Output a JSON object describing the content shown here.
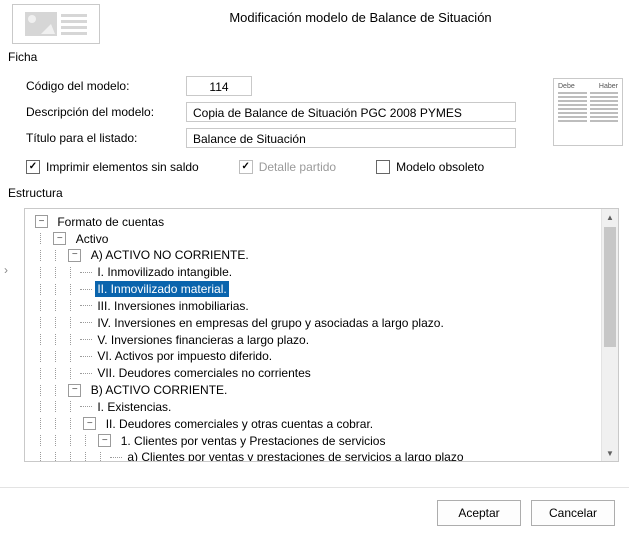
{
  "header": {
    "title": "Modificación  modelo de Balance de Situación"
  },
  "ficha": {
    "section": "Ficha",
    "codigo_lbl": "Código del modelo:",
    "codigo_val": "114",
    "desc_lbl": "Descripción del modelo:",
    "desc_val": "Copia de Balance de Situación PGC 2008 PYMES",
    "titulo_lbl": "Título para el listado:",
    "titulo_val": "Balance de Situación",
    "chk_imprimir": "Imprimir elementos sin saldo",
    "chk_detalle": "Detalle partido",
    "chk_obsoleto": "Modelo obsoleto",
    "preview_left": "Debe",
    "preview_right": "Haber"
  },
  "estructura": {
    "section": "Estructura",
    "nodes": {
      "root": "Formato de cuentas",
      "activo": "Activo",
      "a": "A) ACTIVO NO CORRIENTE.",
      "a1": "I. Inmovilizado intangible.",
      "a2": "II. Inmovilizado material.",
      "a3": "III. Inversiones inmobiliarias.",
      "a4": "IV. Inversiones en empresas del grupo y asociadas a largo plazo.",
      "a5": "V. Inversiones financieras a largo plazo.",
      "a6": "VI. Activos por impuesto diferido.",
      "a7": "VII. Deudores comerciales no corrientes",
      "b": "B) ACTIVO CORRIENTE.",
      "b1": "I. Existencias.",
      "b2": "II. Deudores comerciales y otras cuentas a cobrar.",
      "b2_1": "1. Clientes por ventas y Prestaciones de servicios",
      "b2_1a": "a) Clientes por ventas y prestaciones de servicios a largo plazo"
    }
  },
  "footer": {
    "ok": "Aceptar",
    "cancel": "Cancelar"
  }
}
